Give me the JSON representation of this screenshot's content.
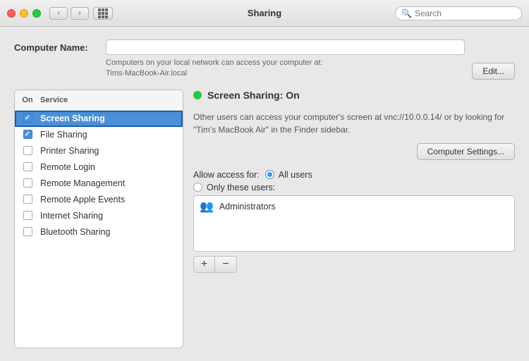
{
  "titlebar": {
    "title": "Sharing",
    "search_placeholder": "Search"
  },
  "computer_name": {
    "label": "Computer Name:",
    "value": "",
    "description": "Computers on your local network can access your computer at:",
    "local_address": "Tims-MacBook-Air.local",
    "edit_label": "Edit..."
  },
  "sidebar": {
    "header_on": "On",
    "header_service": "Service",
    "items": [
      {
        "id": "screen-sharing",
        "label": "Screen Sharing",
        "checked": true,
        "selected": true
      },
      {
        "id": "file-sharing",
        "label": "File Sharing",
        "checked": true,
        "selected": false
      },
      {
        "id": "printer-sharing",
        "label": "Printer Sharing",
        "checked": false,
        "selected": false
      },
      {
        "id": "remote-login",
        "label": "Remote Login",
        "checked": false,
        "selected": false
      },
      {
        "id": "remote-management",
        "label": "Remote Management",
        "checked": false,
        "selected": false
      },
      {
        "id": "remote-apple-events",
        "label": "Remote Apple Events",
        "checked": false,
        "selected": false
      },
      {
        "id": "internet-sharing",
        "label": "Internet Sharing",
        "checked": false,
        "selected": false
      },
      {
        "id": "bluetooth-sharing",
        "label": "Bluetooth Sharing",
        "checked": false,
        "selected": false
      }
    ]
  },
  "detail": {
    "status_on": true,
    "status_title": "Screen Sharing: On",
    "status_description": "Other users can access your computer's screen at vnc://10.0.0.14/ or by looking for \"Tim's MacBook Air\" in the Finder sidebar.",
    "computer_settings_label": "Computer Settings...",
    "access_label": "Allow access for:",
    "radio_options": [
      {
        "id": "all-users",
        "label": "All users",
        "selected": true
      },
      {
        "id": "only-these",
        "label": "Only these users:",
        "selected": false
      }
    ],
    "users": [
      {
        "icon": "👥",
        "name": "Administrators"
      }
    ],
    "toolbar": {
      "add_label": "+",
      "remove_label": "−"
    }
  }
}
